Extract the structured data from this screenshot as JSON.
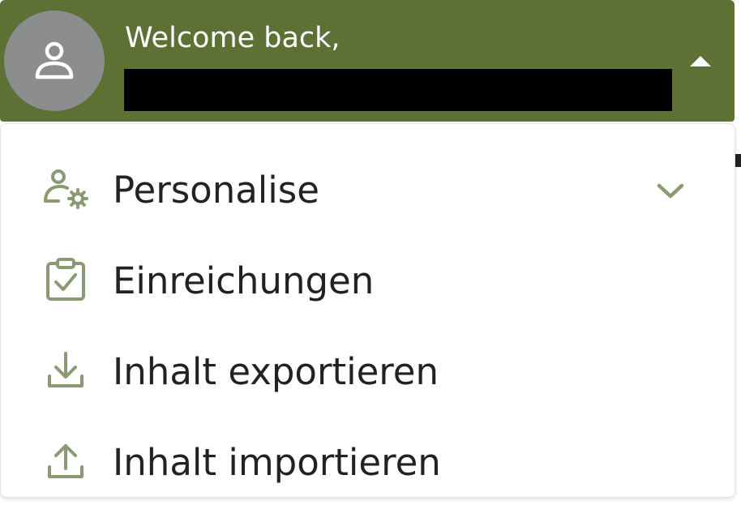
{
  "header": {
    "greeting": "Welcome back,",
    "avatar_icon": "user-icon",
    "collapse_icon": "caret-up-icon",
    "background_color": "#5e7134"
  },
  "menu": {
    "icon_color": "#8a9a73",
    "items": [
      {
        "label": "Personalise",
        "icon": "user-settings-icon",
        "expand_icon": "chevron-down-icon"
      },
      {
        "label": "Einreichungen",
        "icon": "clipboard-check-icon"
      },
      {
        "label": "Inhalt exportieren",
        "icon": "download-icon"
      },
      {
        "label": "Inhalt importieren",
        "icon": "upload-icon"
      }
    ]
  }
}
